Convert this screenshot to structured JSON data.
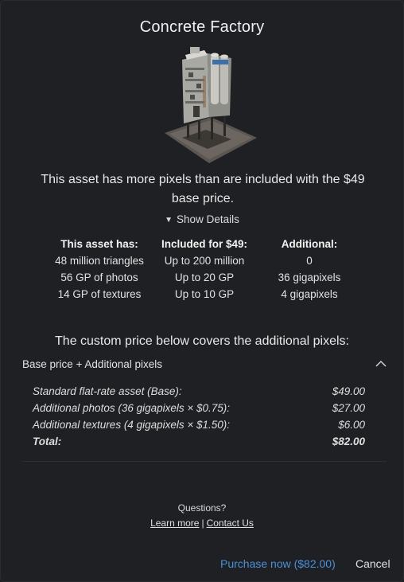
{
  "dialog": {
    "title": "Concrete Factory",
    "thumbnail_icon": "concrete-factory-3d-model-thumbnail",
    "message": "This asset has more pixels than are included with the $49 base price.",
    "details_toggle": {
      "arrow": "▼",
      "label": "Show Details"
    },
    "comparison": {
      "headers": [
        "This asset has:",
        "Included for $49:",
        "Additional:"
      ],
      "rows": [
        [
          "48 million triangles",
          "Up to 200 million",
          "0"
        ],
        [
          "56 GP of photos",
          "Up to 20 GP",
          "36 gigapixels"
        ],
        [
          "14 GP of textures",
          "Up to 10 GP",
          "4 gigapixels"
        ]
      ]
    },
    "covers_text": "The custom price below covers the additional pixels:",
    "accordion": {
      "label": "Base price + Additional pixels",
      "icon": "chevron-up-icon"
    },
    "breakdown": [
      {
        "label": "Standard flat-rate asset (Base):",
        "value": "$49.00"
      },
      {
        "label": "Additional photos (36 gigapixels × $0.75):",
        "value": "$27.00"
      },
      {
        "label": "Additional textures (4 gigapixels × $1.50):",
        "value": "$6.00"
      },
      {
        "label": "Total:",
        "value": "$82.00"
      }
    ],
    "questions": "Questions?",
    "learn_more": "Learn more",
    "separator": "|",
    "contact_us": "Contact Us",
    "purchase_label": "Purchase now ($82.00)",
    "cancel_label": "Cancel"
  },
  "colors": {
    "background": "#1f2023",
    "accent_link": "#4a90d9",
    "text": "#e6e6e6"
  }
}
